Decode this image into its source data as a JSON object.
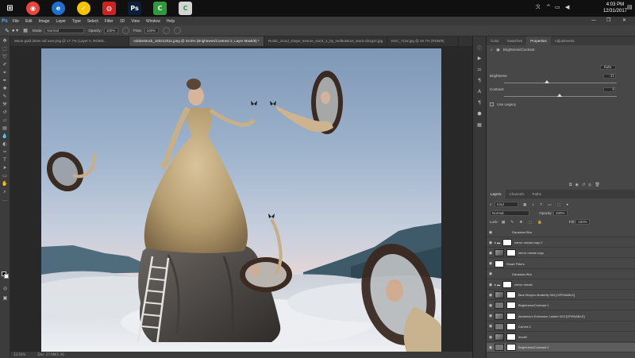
{
  "taskbar": {
    "apps": [
      {
        "name": "chrome-icon",
        "color": "#e8453c",
        "glyph": "◉"
      },
      {
        "name": "edge-icon",
        "color": "#1f6fd1",
        "glyph": "e"
      },
      {
        "name": "norton-icon",
        "color": "#f5c400",
        "glyph": "✓"
      },
      {
        "name": "red-app-icon",
        "color": "#cc2222",
        "glyph": "◍"
      },
      {
        "name": "photoshop-icon",
        "color": "#0b1e3a",
        "glyph": "Ps"
      },
      {
        "name": "camtasia-icon",
        "color": "#2f9a3a",
        "glyph": "C"
      },
      {
        "name": "camtasia-recorder-icon",
        "color": "#d4d4d4",
        "glyph": "C"
      }
    ],
    "time": "4:03 PM",
    "date": "12/31/2017"
  },
  "menubar": {
    "logo": "Ps",
    "items": [
      "File",
      "Edit",
      "Image",
      "Layer",
      "Type",
      "Select",
      "Filter",
      "3D",
      "View",
      "Window",
      "Help"
    ]
  },
  "options": {
    "mode_label": "Mode:",
    "mode_value": "Normal",
    "opacity_label": "Opacity:",
    "opacity_value": "100%",
    "flow_label": "Flow:",
    "flow_value": "100%"
  },
  "doc_tabs": [
    {
      "label": "Moon gold dress rail over.png @ 17.7% (Layer 0, RGB/8...",
      "active": false
    },
    {
      "label": "AdobeStock_183212011.jpeg @ 33.5% (Brightness/Contrast 2, Layer Mask/8) *",
      "active": true
    },
    {
      "label": "Rustic_cloud_shape_texture_stock_1_by_melbutstoxt_stock-d41g2c.jpg",
      "active": false
    },
    {
      "label": "DSC_7118.jpg @ 16.7% (RGB/8)",
      "active": false
    }
  ],
  "status": {
    "zoom": "33.54%",
    "doc": "Doc: 27.6M/1.3G"
  },
  "properties": {
    "tabs": [
      "Color",
      "Swatches",
      "Properties",
      "Adjustments"
    ],
    "active_tab": "Properties",
    "title": "Brightness/Contrast",
    "auto_label": "Auto",
    "brightness_label": "Brightness:",
    "brightness_value": "-11",
    "contrast_label": "Contrast:",
    "contrast_value": "0",
    "legacy_label": "Use Legacy"
  },
  "layers": {
    "tabs": [
      "Layers",
      "Channels",
      "Paths"
    ],
    "active_tab": "Layers",
    "filter_label": "Kind",
    "blend_mode": "Normal",
    "opacity_label": "Opacity:",
    "opacity_value": "100%",
    "lock_label": "Lock:",
    "fill_label": "Fill:",
    "fill_value": "100%",
    "rows": [
      {
        "name": "Gaussian Blur",
        "type": "effect",
        "selected": false
      },
      {
        "name": "mirror medal copy 2",
        "type": "group",
        "selected": false
      },
      {
        "name": "mirror medal copy",
        "type": "img",
        "selected": false
      },
      {
        "name": "Smart Filters",
        "type": "mask",
        "selected": false
      },
      {
        "name": "Gaussian Blur",
        "type": "effect",
        "selected": false
      },
      {
        "name": "mirror medal",
        "type": "group",
        "selected": false
      },
      {
        "name": "Blue Morpho Butterfly 003 [OPENABLE]",
        "type": "img",
        "selected": false
      },
      {
        "name": "Brightness/Contrast 1",
        "type": "adj",
        "selected": false
      },
      {
        "name": "Aluminium Extension Ladder 003 [OPENABLE]",
        "type": "img",
        "selected": false
      },
      {
        "name": "Curves 1",
        "type": "adj",
        "selected": false
      },
      {
        "name": "model",
        "type": "img",
        "selected": false
      },
      {
        "name": "Brightness/Contrast 2",
        "type": "adj",
        "selected": true
      }
    ]
  }
}
